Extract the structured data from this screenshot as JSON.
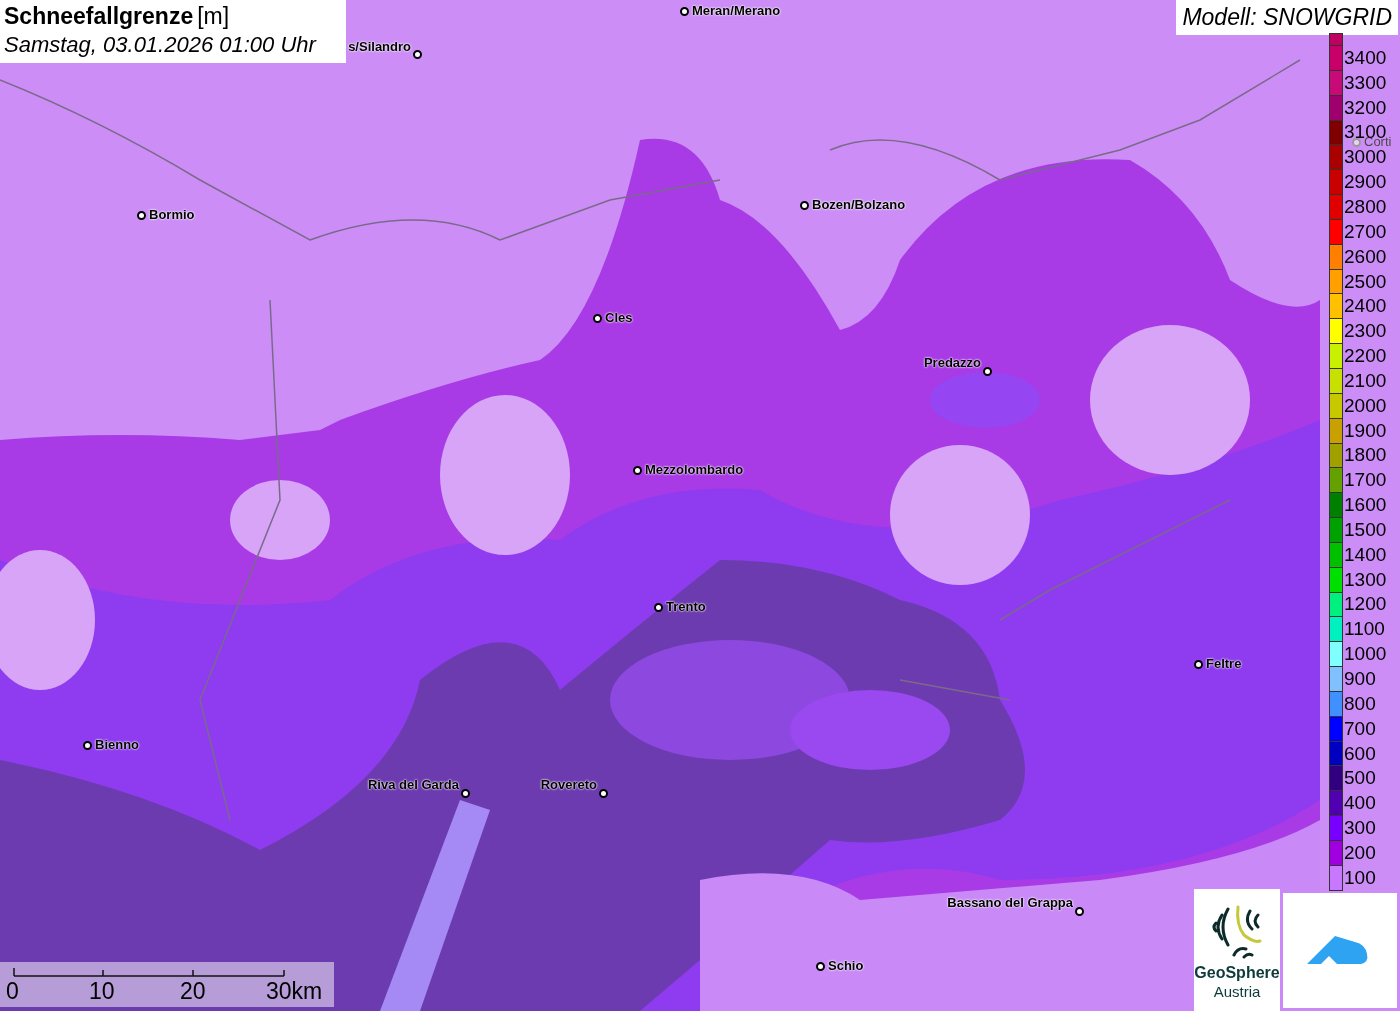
{
  "title": {
    "name": "Schneefallgrenze",
    "unit": "[m]",
    "time": "Samstag, 03.01.2026 01:00 Uhr"
  },
  "model": "Modell: SNOWGRID",
  "cities": [
    {
      "name": "Meran/Merano",
      "faded": false
    },
    {
      "name": "s/Silandro",
      "faded": false
    },
    {
      "name": "Bormio",
      "faded": false
    },
    {
      "name": "Bozen/Bolzano",
      "faded": false
    },
    {
      "name": "Cles",
      "faded": false
    },
    {
      "name": "Predazzo",
      "faded": false
    },
    {
      "name": "Mezzolombardo",
      "faded": false
    },
    {
      "name": "Trento",
      "faded": false
    },
    {
      "name": "Feltre",
      "faded": false
    },
    {
      "name": "Bienno",
      "faded": false
    },
    {
      "name": "Riva del Garda",
      "faded": false
    },
    {
      "name": "Rovereto",
      "faded": false
    },
    {
      "name": "Bassano del Grappa",
      "faded": false
    },
    {
      "name": "Schio",
      "faded": false
    },
    {
      "name": "Corti",
      "faded": true
    }
  ],
  "legend": [
    {
      "label": "3400",
      "color": "#c8006a"
    },
    {
      "label": "3300",
      "color": "#c80a78"
    },
    {
      "label": "3200",
      "color": "#a0006e"
    },
    {
      "label": "3100",
      "color": "#800000"
    },
    {
      "label": "3000",
      "color": "#aa0000"
    },
    {
      "label": "2900",
      "color": "#c80000"
    },
    {
      "label": "2800",
      "color": "#e00000"
    },
    {
      "label": "2700",
      "color": "#ff0000"
    },
    {
      "label": "2600",
      "color": "#ff8000"
    },
    {
      "label": "2500",
      "color": "#ffa000"
    },
    {
      "label": "2400",
      "color": "#ffc000"
    },
    {
      "label": "2300",
      "color": "#ffff00"
    },
    {
      "label": "2200",
      "color": "#c8f000"
    },
    {
      "label": "2100",
      "color": "#c8e000"
    },
    {
      "label": "2000",
      "color": "#c8c800"
    },
    {
      "label": "1900",
      "color": "#c8a000"
    },
    {
      "label": "1800",
      "color": "#a0a000"
    },
    {
      "label": "1700",
      "color": "#64a000"
    },
    {
      "label": "1600",
      "color": "#008000"
    },
    {
      "label": "1500",
      "color": "#00a000"
    },
    {
      "label": "1400",
      "color": "#00c000"
    },
    {
      "label": "1300",
      "color": "#00e000"
    },
    {
      "label": "1200",
      "color": "#00f080"
    },
    {
      "label": "1100",
      "color": "#00f0c0"
    },
    {
      "label": "1000",
      "color": "#80ffff"
    },
    {
      "label": "900",
      "color": "#80c0ff"
    },
    {
      "label": "800",
      "color": "#4090ff"
    },
    {
      "label": "700",
      "color": "#0000ff"
    },
    {
      "label": "600",
      "color": "#0000c0"
    },
    {
      "label": "500",
      "color": "#300080"
    },
    {
      "label": "400",
      "color": "#5000b0"
    },
    {
      "label": "300",
      "color": "#7800ff"
    },
    {
      "label": "200",
      "color": "#a000e0"
    },
    {
      "label": "100",
      "color": "#c878ff"
    }
  ],
  "scale_bar": [
    "0",
    "10",
    "20",
    "30km"
  ],
  "logo": {
    "name": "GeoSphere",
    "sub": "Austria"
  }
}
